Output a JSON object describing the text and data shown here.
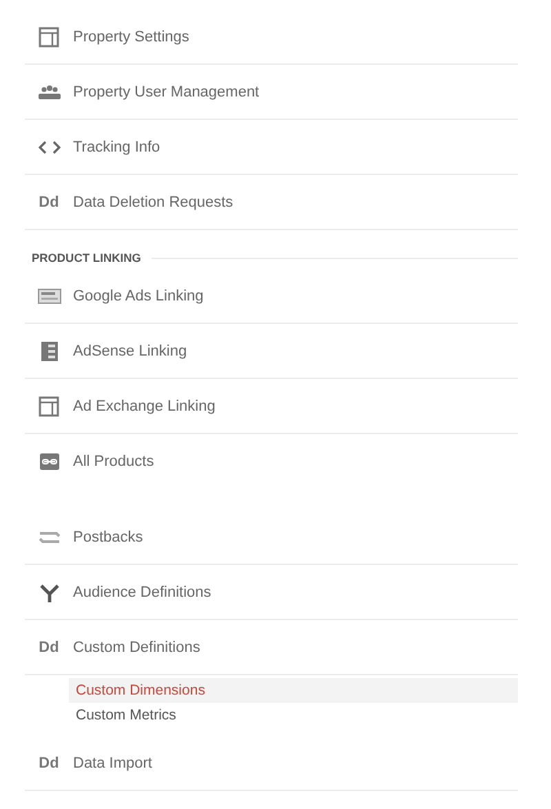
{
  "sections": [
    {
      "items": [
        {
          "label": "Property Settings",
          "kind": "icon"
        },
        {
          "label": "Property User Management",
          "kind": "icon"
        },
        {
          "label": "Tracking Info",
          "kind": "icon"
        },
        {
          "label": "Data Deletion Requests",
          "kind": "text-icon",
          "icon_text": "Dd"
        }
      ]
    },
    {
      "heading": "PRODUCT LINKING",
      "items": [
        {
          "label": "Google Ads Linking",
          "kind": "icon"
        },
        {
          "label": "AdSense Linking",
          "kind": "icon"
        },
        {
          "label": "Ad Exchange Linking",
          "kind": "icon"
        },
        {
          "label": "All Products",
          "kind": "icon"
        }
      ]
    },
    {
      "items": [
        {
          "label": "Postbacks",
          "kind": "icon"
        },
        {
          "label": "Audience Definitions",
          "kind": "icon"
        },
        {
          "label": "Custom Definitions",
          "kind": "text-icon",
          "icon_text": "Dd",
          "children": [
            {
              "label": "Custom Dimensions",
              "selected": true
            },
            {
              "label": "Custom Metrics",
              "selected": false
            }
          ]
        },
        {
          "label": "Data Import",
          "kind": "text-icon",
          "icon_text": "Dd"
        }
      ]
    }
  ]
}
